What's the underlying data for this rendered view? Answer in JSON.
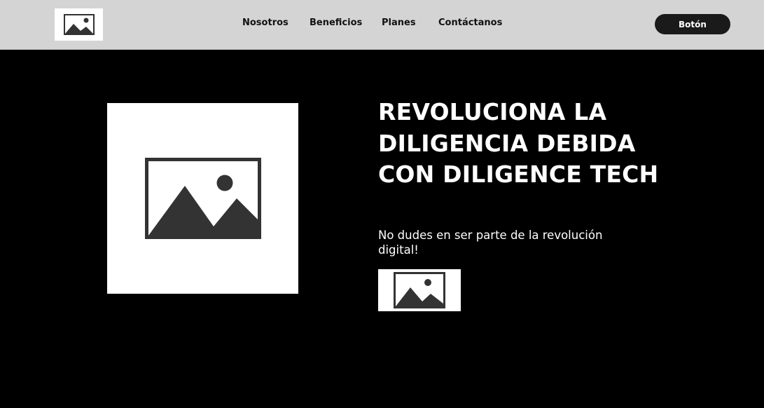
{
  "navbar": {
    "logo_icon": "image-placeholder-icon",
    "links": [
      "Nosotros",
      "Beneficios",
      "Planes",
      "Contáctanos"
    ],
    "button_label": "Botón"
  },
  "hero": {
    "image_icon": "image-placeholder-icon",
    "title": "REVOLUCIONA LA DILIGENCIA DEBIDA CON DILIGENCE TECH",
    "subtitle": "No dudes en ser parte de la revolución digital!",
    "small_image_icon": "image-placeholder-icon"
  },
  "colors": {
    "nav_background": "#d4d4d4",
    "page_background": "#000000",
    "button_background": "#1a1a1a",
    "placeholder_fill": "#333333"
  }
}
